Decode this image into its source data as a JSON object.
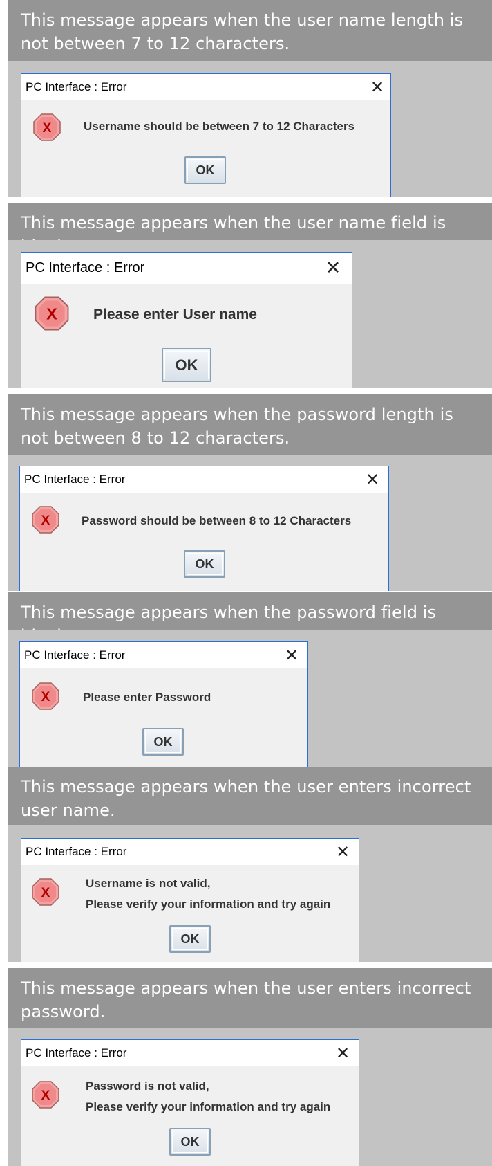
{
  "messages": [
    {
      "caption": "This message appears when the user name length is not between 7 to 12 characters.",
      "dialog_title": "PC Interface : Error",
      "text_lines": [
        "Username should be between 7 to 12 Characters"
      ],
      "ok_label": "OK"
    },
    {
      "caption": "This message appears when the user name field is blank.",
      "dialog_title": "PC Interface : Error",
      "text_lines": [
        "Please enter User name"
      ],
      "ok_label": "OK"
    },
    {
      "caption": "This message appears when the password length is not between 8 to 12 characters.",
      "dialog_title": "PC Interface : Error",
      "text_lines": [
        "Password should be between 8 to 12 Characters"
      ],
      "ok_label": "OK"
    },
    {
      "caption": "This message appears when the password field is blank.",
      "dialog_title": "PC Interface : Error",
      "text_lines": [
        "Please enter Password"
      ],
      "ok_label": "OK"
    },
    {
      "caption": "This message appears when the user enters incorrect user name.",
      "dialog_title": "PC Interface : Error",
      "text_lines": [
        "Username is not valid,",
        "Please verify your information and try again"
      ],
      "ok_label": "OK"
    },
    {
      "caption": "This message appears when the user enters incorrect password.",
      "dialog_title": "PC Interface : Error",
      "text_lines": [
        "Password is not valid,",
        "Please verify your information and try again"
      ],
      "ok_label": "OK"
    }
  ],
  "icons": {
    "close": "close-icon",
    "error": "error-icon"
  },
  "colors": {
    "caption_bg": "#959595",
    "pane_bg": "#c3c3c3",
    "dialog_border": "#2a6fd6",
    "error_icon": "#e03a3a"
  }
}
